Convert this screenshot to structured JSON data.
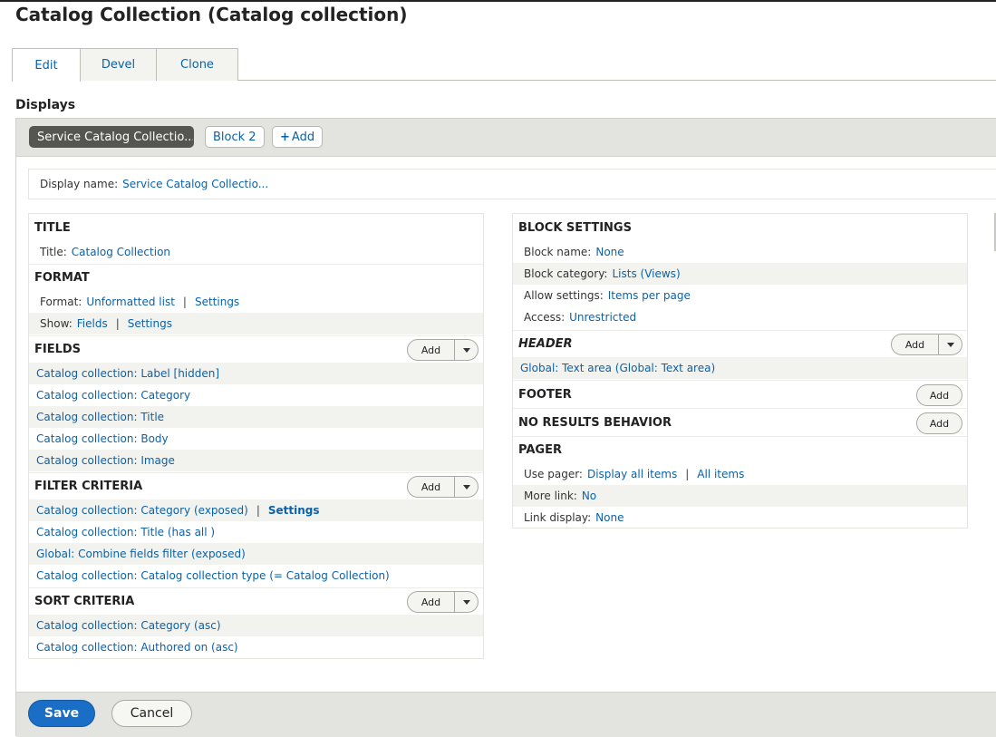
{
  "page": {
    "title": "Catalog Collection (Catalog collection)"
  },
  "tabs": [
    {
      "label": "Edit"
    },
    {
      "label": "Devel"
    },
    {
      "label": "Clone"
    }
  ],
  "displays": {
    "heading": "Displays",
    "active_display": "Service Catalog Collectio...",
    "other_display": "Block 2",
    "add_label": "Add"
  },
  "display_name": {
    "label": "Display name:",
    "value": "Service Catalog Collectio..."
  },
  "buttons": {
    "add": "Add"
  },
  "left": {
    "title": {
      "heading": "TITLE",
      "label": "Title:",
      "value": "Catalog Collection"
    },
    "format": {
      "heading": "FORMAT",
      "format_label": "Format:",
      "format_value": "Unformatted list",
      "format_settings": "Settings",
      "show_label": "Show:",
      "show_value": "Fields",
      "show_settings": "Settings"
    },
    "fields": {
      "heading": "FIELDS",
      "items": [
        "Catalog collection: Label [hidden]",
        "Catalog collection: Category",
        "Catalog collection: Title",
        "Catalog collection: Body",
        "Catalog collection: Image"
      ]
    },
    "filter": {
      "heading": "FILTER CRITERIA",
      "items": [
        "Catalog collection: Category (exposed)",
        "Catalog collection: Title (has all )",
        "Global: Combine fields filter (exposed)",
        "Catalog collection: Catalog collection type (= Catalog Collection)"
      ],
      "settings": "Settings"
    },
    "sort": {
      "heading": "SORT CRITERIA",
      "items": [
        "Catalog collection: Category (asc)",
        "Catalog collection: Authored on (asc)"
      ]
    }
  },
  "right": {
    "block": {
      "heading": "BLOCK SETTINGS",
      "name_label": "Block name:",
      "name_value": "None",
      "category_label": "Block category:",
      "category_value": "Lists (Views)",
      "allow_label": "Allow settings:",
      "allow_value": "Items per page",
      "access_label": "Access:",
      "access_value": "Unrestricted"
    },
    "header": {
      "heading": "HEADER",
      "item": "Global: Text area (Global: Text area)"
    },
    "footer": {
      "heading": "FOOTER"
    },
    "noresults": {
      "heading": "NO RESULTS BEHAVIOR"
    },
    "pager": {
      "heading": "PAGER",
      "use_label": "Use pager:",
      "use_value": "Display all items",
      "use_extra": "All items",
      "more_label": "More link:",
      "more_value": "No",
      "link_label": "Link display:",
      "link_value": "None"
    }
  },
  "actions": {
    "save": "Save",
    "cancel": "Cancel"
  },
  "colors": {
    "link": "#0b62a8",
    "primary": "#1a6ec5",
    "active_tab_bg": "#555551"
  }
}
